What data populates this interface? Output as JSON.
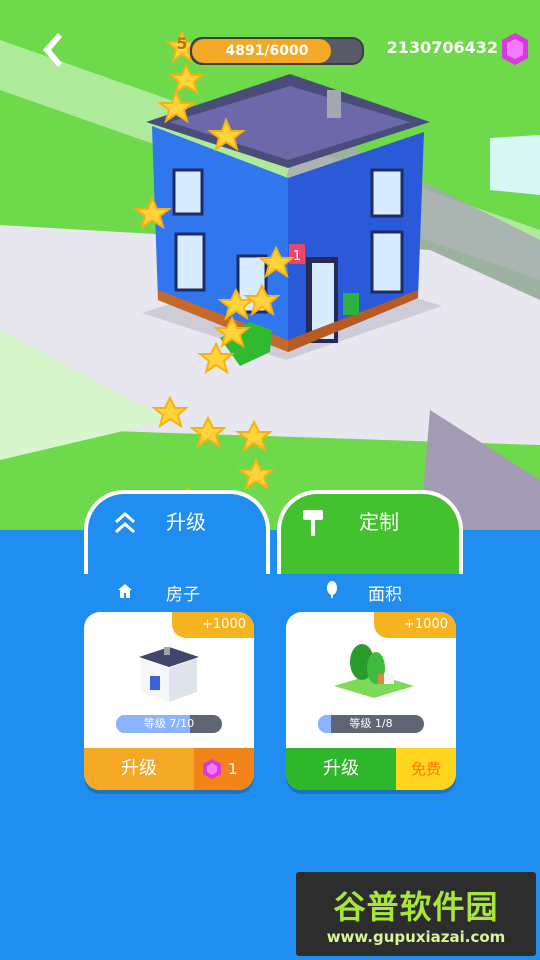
{
  "hud": {
    "level": "5",
    "xp_text": "4891/6000",
    "xp_progress": 0.815,
    "gems": "2130706432"
  },
  "tabs": {
    "upgrade_label": "升级",
    "custom_label": "定制"
  },
  "sections": {
    "house_label": "房子",
    "area_label": "面积"
  },
  "cards": [
    {
      "reward": "+1000",
      "level_text": "等级 7/10",
      "level_progress": 0.7,
      "main_button": "升级",
      "side_text": "1"
    },
    {
      "reward": "+1000",
      "level_text": "等级 1/8",
      "level_progress": 0.125,
      "main_button": "升级",
      "side_text": "免费"
    }
  ],
  "building": {
    "door_badge": "1"
  },
  "watermark": {
    "title": "谷普软件园",
    "url": "www.gupuxiazai.com"
  },
  "colors": {
    "panel_blue": "#1f8ef0",
    "grass": "#6ed94a",
    "orange": "#f3a826",
    "green_button": "#2fb72b",
    "gem_pink": "#d83ae0"
  }
}
